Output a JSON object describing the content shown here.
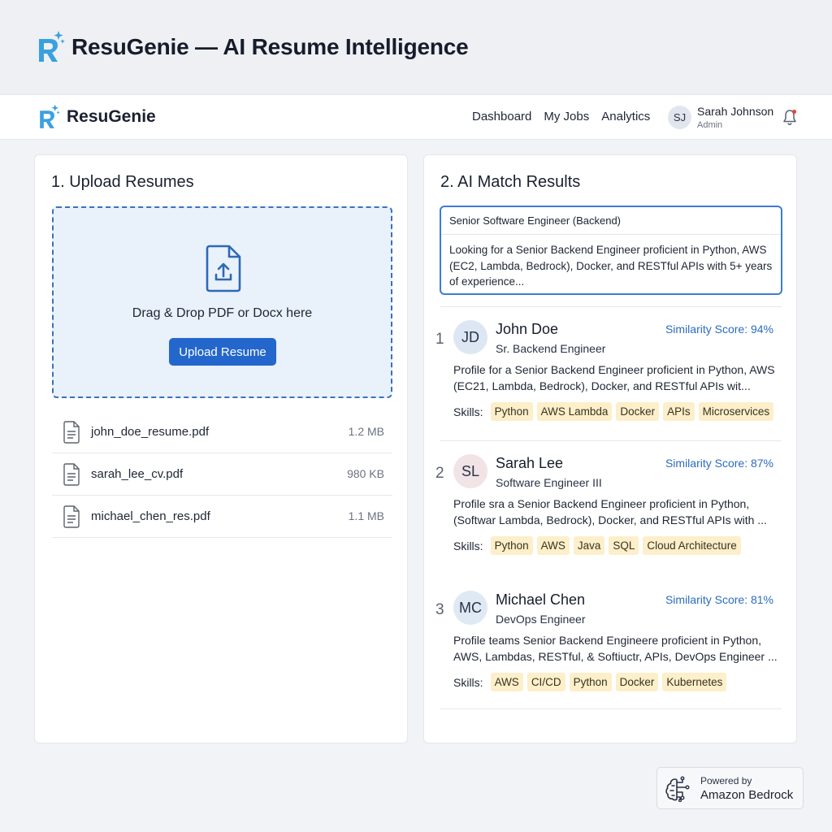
{
  "page": {
    "title": "ResuGenie — AI Resume Intelligence"
  },
  "nav": {
    "brand": "ResuGenie",
    "links": [
      "Dashboard",
      "My Jobs",
      "Analytics"
    ],
    "user": {
      "initials": "SJ",
      "name": "Sarah Johnson",
      "role": "Admin"
    }
  },
  "upload": {
    "heading": "1. Upload Resumes",
    "drop_text": "Drag & Drop PDF or Docx here",
    "button": "Upload Resume",
    "files": [
      {
        "name": "john_doe_resume.pdf",
        "size": "1.2 MB"
      },
      {
        "name": "sarah_lee_cv.pdf",
        "size": "980 KB"
      },
      {
        "name": "michael_chen_res.pdf",
        "size": "1.1 MB"
      }
    ]
  },
  "match": {
    "heading": "2. AI Match Results",
    "job_title": "Senior Software Engineer (Backend)",
    "job_description": "Looking for a Senior Backend Engineer proficient in Python, AWS (EC2, Lambda, Bedrock), Docker, and RESTful APIs with 5+ years of experience...",
    "skills_label": "Skills:",
    "results": [
      {
        "rank": "1",
        "initials": "JD",
        "avatar_color": "#dde7f4",
        "name": "John Doe",
        "role": "Sr. Backend Engineer",
        "score": "Similarity Score: 94%",
        "summary": "Profile for a Senior Backend Engineer proficient in Python, AWS (EC21, Lambda, Bedrock), Docker, and RESTful APIs wit...",
        "skills": [
          "Python",
          "AWS Lambda",
          "Docker",
          "APIs",
          "Microservices"
        ]
      },
      {
        "rank": "2",
        "initials": "SL",
        "avatar_color": "#f1e3e6",
        "name": "Sarah Lee",
        "role": "Software Engineer III",
        "score": "Similarity Score: 87%",
        "summary": "Profile sra a Senior Backend Engineer proficient in Python, (Softwar Lambda, Bedrock), Docker, and RESTful APIs with ...",
        "skills": [
          "Python",
          "AWS",
          "Java",
          "SQL",
          "Cloud Architecture"
        ]
      },
      {
        "rank": "3",
        "initials": "MC",
        "avatar_color": "#dfe9f3",
        "name": "Michael Chen",
        "role": "DevOps Engineer",
        "score": "Similarity Score: 81%",
        "summary": "Profile teams Senior Backend Engineere proficient in Python, AWS, Lambdas, RESTful, & Softiuctr, APIs, DevOps Engineer ...",
        "skills": [
          "AWS",
          "CI/CD",
          "Python",
          "Docker",
          "Kubernetes"
        ]
      }
    ]
  },
  "powered": {
    "line1": "Powered by",
    "line2": "Amazon Bedrock"
  },
  "colors": {
    "accent": "#2467cc",
    "score": "#2c6bbf",
    "tag_bg": "#fcefc9",
    "dropzone_bg": "#e9f1fb"
  }
}
